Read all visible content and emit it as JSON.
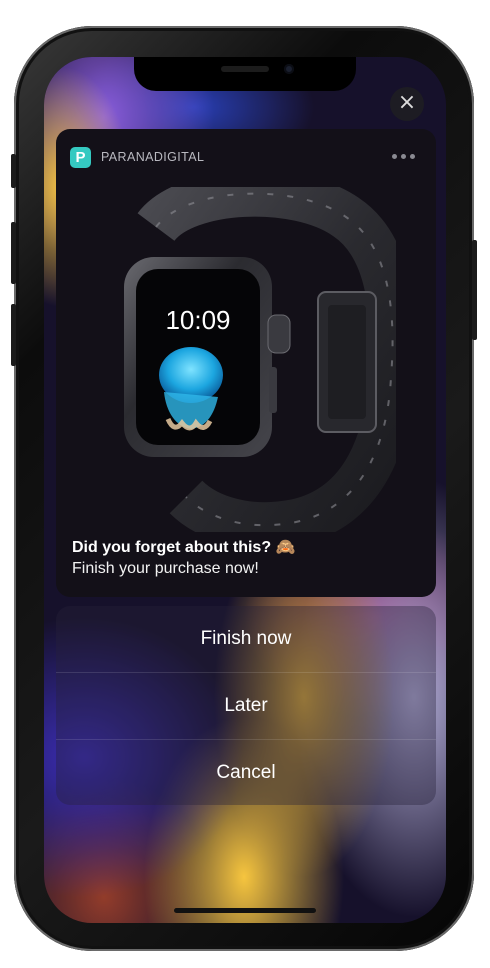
{
  "notification": {
    "app_name": "PARANADIGITAL",
    "app_icon_letter": "P",
    "title": "Did you forget about this? 🙈",
    "body": "Finish your purchase now!",
    "product_watch_time": "10:09",
    "colors": {
      "app_icon": "#35c9c1",
      "card_background": "#131018"
    }
  },
  "close_icon": "×",
  "actions": [
    {
      "label": "Finish now"
    },
    {
      "label": "Later"
    },
    {
      "label": "Cancel"
    }
  ]
}
